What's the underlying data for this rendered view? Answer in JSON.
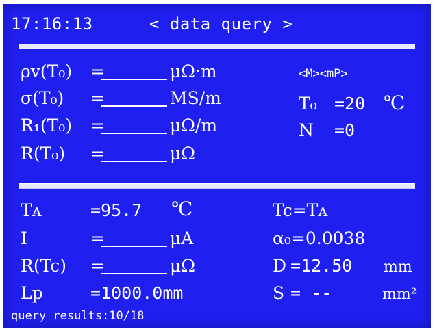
{
  "header": {
    "time": "17:16:13",
    "title": "< data query >"
  },
  "upper": {
    "rho": {
      "label": "ρv(T₀)",
      "eq": "=",
      "unit": "μΩ·m"
    },
    "sigma": {
      "label": "σ(T₀)",
      "eq": "=",
      "unit": "MS/m"
    },
    "r1": {
      "label": "R₁(T₀)",
      "eq": "=",
      "unit": "μΩ/m"
    },
    "r": {
      "label": "R(T₀)",
      "eq": "=",
      "unit": "μΩ"
    },
    "mode": "<M><mP>",
    "t0": {
      "label": "T₀",
      "value": "=20",
      "unit": "℃"
    },
    "n": {
      "label": "N",
      "value": "=0"
    }
  },
  "lower": {
    "ta": {
      "label": "Tᴀ",
      "value": "=95.7",
      "unit": "℃"
    },
    "i": {
      "label": "I",
      "eq": "=",
      "unit": "μA"
    },
    "rtc": {
      "label": "R(Tc)",
      "eq": "=",
      "unit": "μΩ"
    },
    "lp": {
      "label": "Lp",
      "value": "=1000.0mm"
    },
    "tc": {
      "value": "Tc=Tᴀ"
    },
    "alpha": {
      "value": "α₀=0.0038"
    },
    "d": {
      "label": "D",
      "value": "=12.50",
      "unit": "mm"
    },
    "s": {
      "label": "S",
      "value": "= --",
      "unit": "mm²"
    }
  },
  "footer": {
    "query_results": "query results:10/18"
  }
}
